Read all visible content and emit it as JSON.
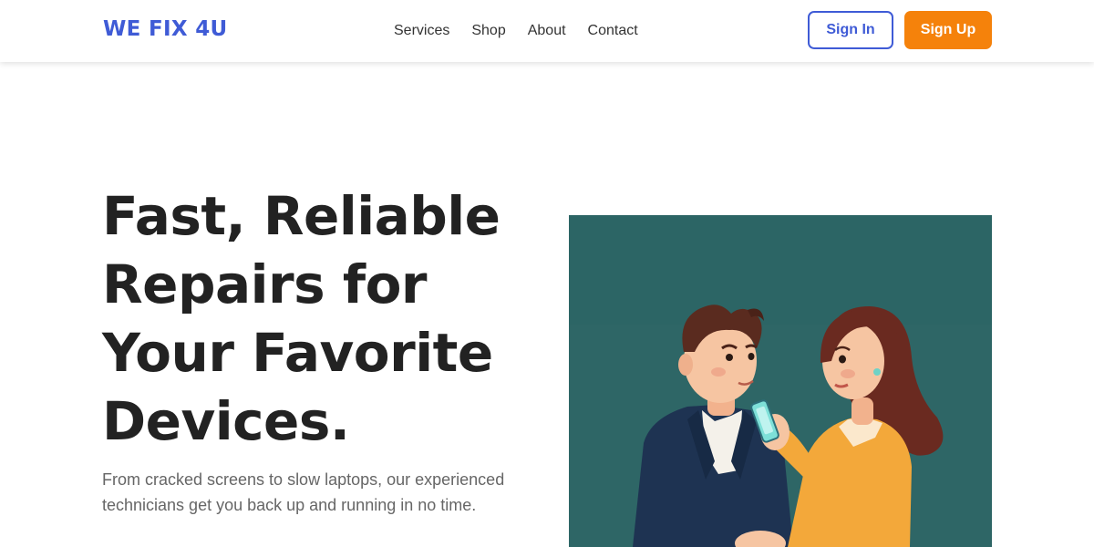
{
  "brand": {
    "name": "WE FIX 4U",
    "color": "#3f5bd6"
  },
  "nav": {
    "links": [
      {
        "label": "Services"
      },
      {
        "label": "Shop"
      },
      {
        "label": "About"
      },
      {
        "label": "Contact"
      }
    ]
  },
  "auth": {
    "sign_in_label": "Sign In",
    "sign_up_label": "Sign Up",
    "sign_up_color": "#f5820b"
  },
  "hero": {
    "title": "Fast, Reliable Repairs for Your Favorite Devices.",
    "subtitle": "From cracked screens to slow laptops, our experienced technicians get you back up and running in no time.",
    "illustration_icon": "couple-with-phone-illustration",
    "illustration_bg": "#2e6666"
  }
}
